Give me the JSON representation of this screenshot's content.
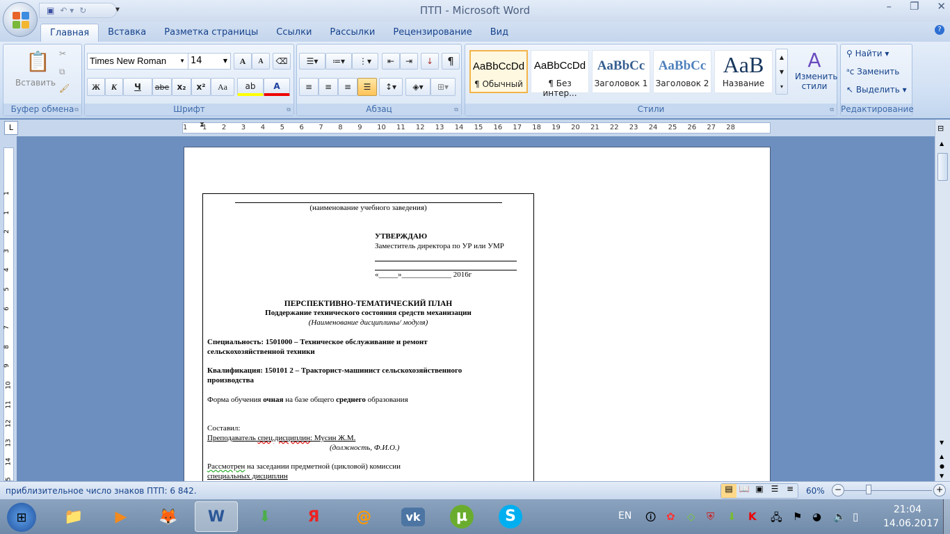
{
  "window": {
    "title": "ПТП - Microsoft Word"
  },
  "quick_access": {
    "icons": [
      "save-icon",
      "undo-icon",
      "redo-icon",
      "customize-icon"
    ]
  },
  "tabs": [
    {
      "label": "Главная",
      "active": true
    },
    {
      "label": "Вставка"
    },
    {
      "label": "Разметка страницы"
    },
    {
      "label": "Ссылки"
    },
    {
      "label": "Рассылки"
    },
    {
      "label": "Рецензирование"
    },
    {
      "label": "Вид"
    }
  ],
  "ribbon": {
    "clipboard": {
      "label": "Буфер обмена",
      "paste": "Вставить"
    },
    "font": {
      "label": "Шрифт",
      "font_name": "Times New Roman",
      "font_size": "14",
      "bold": "Ж",
      "italic": "К",
      "underline": "Ч",
      "strike": "abe",
      "subscript": "x₂",
      "superscript": "x²",
      "case": "Aa",
      "grow": "A",
      "shrink": "A",
      "highlight_color": "#ffff00",
      "font_color": "#e00000"
    },
    "paragraph": {
      "label": "Абзац",
      "active_alignment": "justify"
    },
    "styles": {
      "label": "Стили",
      "items": [
        {
          "preview": "AaBbCcDd",
          "name": "¶ Обычный",
          "selected": true
        },
        {
          "preview": "AaBbCcDd",
          "name": "¶ Без интер..."
        },
        {
          "preview": "AaBbCc",
          "name": "Заголовок 1"
        },
        {
          "preview": "AaBbCc",
          "name": "Заголовок 2"
        },
        {
          "preview": "AaB",
          "name": "Название"
        }
      ],
      "change": "Изменить стили"
    },
    "editing": {
      "label": "Редактирование",
      "find": "Найти",
      "replace": "Заменить",
      "select": "Выделить"
    }
  },
  "ruler": {
    "top_labels": [
      "1",
      "1",
      "2",
      "3",
      "4",
      "5",
      "6",
      "7",
      "8",
      "9",
      "10",
      "11",
      "12",
      "13",
      "14",
      "15",
      "16",
      "17",
      "18",
      "19",
      "20",
      "21",
      "22",
      "23",
      "24",
      "25",
      "26",
      "27",
      "28"
    ],
    "left_labels": [
      "1",
      "1",
      "2",
      "3",
      "4",
      "5",
      "6",
      "7",
      "8",
      "9",
      "10",
      "11",
      "12",
      "13",
      "14",
      "15"
    ]
  },
  "document": {
    "institution_caption": "(наименование  учебного заведения)",
    "approve": "УТВЕРЖДАЮ",
    "deputy": "Заместитель директора  по УР или УМР",
    "date_line": "«_____»_____________  2016г",
    "title": "ПЕРСПЕКТИВНО-ТЕМАТИЧЕСКИЙ ПЛАН",
    "subtitle": "Поддержание технического состояния средств механизации",
    "discipline_caption": "(Наименование дисциплины/ модуля)",
    "specialty_1": "Специальность:  1501000 – Техническое обслуживание и ремонт",
    "specialty_2": "сельскохозяйственной техники",
    "qualification_1": "Квалификация:  150101 2 – Тракторист-машинист сельскохозяйственного",
    "qualification_2": "производства",
    "form_a": "Форма обучения ",
    "form_b": "очная",
    "form_c": " на базе общего ",
    "form_d": "среднего",
    "form_e": " образования",
    "composed": "Составил:",
    "teacher_a": "Преподаватель ",
    "teacher_b": "спец.дисциплин",
    "teacher_c": ":  Мусин Ж.М.",
    "position_caption": "(должность, Ф.И.О.)",
    "reviewed_a": "Рассмотрен",
    "reviewed_b": " на заседании  предметной  (цикловой) комиссии",
    "special": "специальных  дисциплин"
  },
  "status": {
    "word_count": "приблизительное число знаков ПТП: 6 842.",
    "zoom": "60%",
    "zoom_level": 60
  },
  "taskbar": {
    "apps": [
      "start",
      "explorer",
      "media-player",
      "firefox",
      "word",
      "download-manager",
      "yandex",
      "mail-agent",
      "vk",
      "utorrent",
      "skype"
    ],
    "active": "word",
    "lang": "EN",
    "time": "21:04",
    "date": "14.06.2017"
  }
}
